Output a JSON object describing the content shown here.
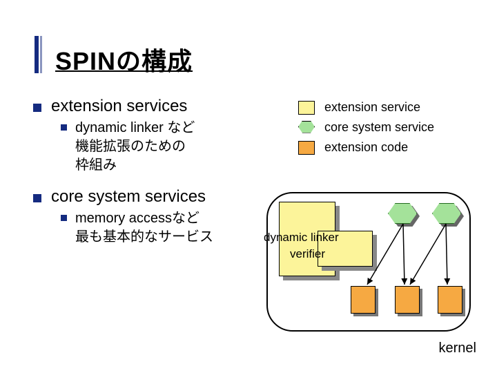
{
  "title": "SPINの構成",
  "bullets": [
    {
      "text": "extension services",
      "sub": [
        "dynamic linker など\n機能拡張のための\n枠組み"
      ]
    },
    {
      "text": "core system services",
      "sub": [
        "memory accessなど\n最も基本的なサービス"
      ]
    }
  ],
  "legend": [
    {
      "label": "extension service",
      "color": "#fcf49a"
    },
    {
      "label": "core system service",
      "color": "#a4e29a"
    },
    {
      "label": "extension code",
      "color": "#f6a942"
    }
  ],
  "diagram": {
    "dynamic_linker": "dynamic linker",
    "verifier": "verifier",
    "kernel": "kernel"
  }
}
